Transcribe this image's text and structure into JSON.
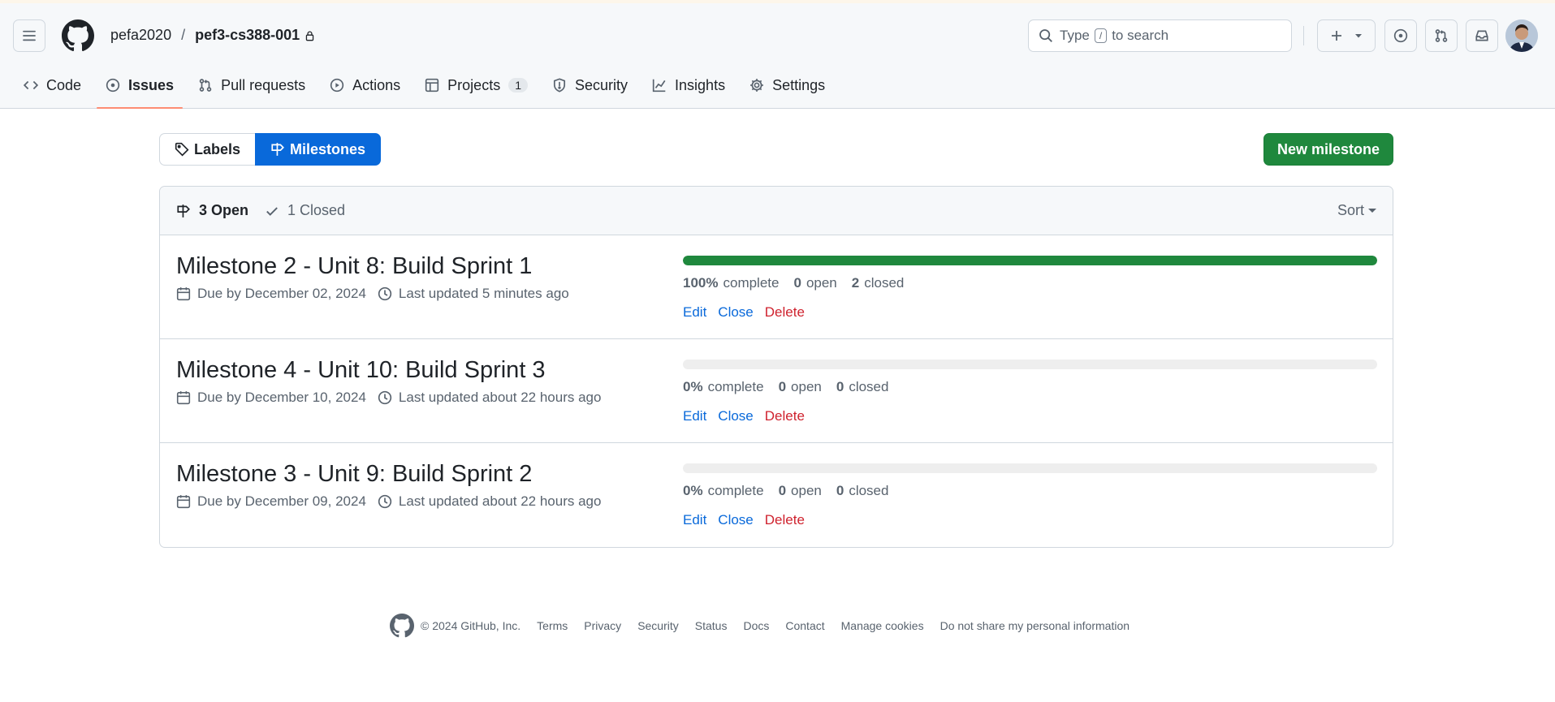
{
  "header": {
    "owner": "pefa2020",
    "separator": "/",
    "repo": "pef3-cs388-001",
    "search_prefix": "Type",
    "search_key": "/",
    "search_suffix": "to search"
  },
  "tabs": [
    {
      "label": "Code",
      "icon": "code-icon"
    },
    {
      "label": "Issues",
      "icon": "issue-opened-icon",
      "active": true
    },
    {
      "label": "Pull requests",
      "icon": "git-pull-request-icon"
    },
    {
      "label": "Actions",
      "icon": "play-icon"
    },
    {
      "label": "Projects",
      "icon": "table-icon",
      "counter": "1"
    },
    {
      "label": "Security",
      "icon": "shield-icon"
    },
    {
      "label": "Insights",
      "icon": "graph-icon"
    },
    {
      "label": "Settings",
      "icon": "gear-icon"
    }
  ],
  "subnav": {
    "labels": "Labels",
    "milestones": "Milestones"
  },
  "new_milestone": "New milestone",
  "list_header": {
    "open": "3 Open",
    "closed": "1 Closed",
    "sort": "Sort"
  },
  "milestones": [
    {
      "title": "Milestone 2 - Unit 8: Build Sprint 1",
      "due": "Due by December 02, 2024",
      "updated": "Last updated 5 minutes ago",
      "percent": "100%",
      "percent_value": 1.0,
      "complete_label": "complete",
      "open": "0",
      "open_label": "open",
      "closed": "2",
      "closed_label": "closed"
    },
    {
      "title": "Milestone 4 - Unit 10: Build Sprint 3",
      "due": "Due by December 10, 2024",
      "updated": "Last updated about 22 hours ago",
      "percent": "0%",
      "percent_value": 0.0,
      "complete_label": "complete",
      "open": "0",
      "open_label": "open",
      "closed": "0",
      "closed_label": "closed"
    },
    {
      "title": "Milestone 3 - Unit 9: Build Sprint 2",
      "due": "Due by December 09, 2024",
      "updated": "Last updated about 22 hours ago",
      "percent": "0%",
      "percent_value": 0.0,
      "complete_label": "complete",
      "open": "0",
      "open_label": "open",
      "closed": "0",
      "closed_label": "closed"
    }
  ],
  "actions": {
    "edit": "Edit",
    "close": "Close",
    "delete": "Delete"
  },
  "footer": {
    "copyright": "© 2024 GitHub, Inc.",
    "links": [
      "Terms",
      "Privacy",
      "Security",
      "Status",
      "Docs",
      "Contact",
      "Manage cookies",
      "Do not share my personal information"
    ]
  },
  "colors": {
    "accent": "#0969da",
    "success": "#1f883d",
    "danger": "#cf222e",
    "tab_underline": "#fd8c73"
  }
}
